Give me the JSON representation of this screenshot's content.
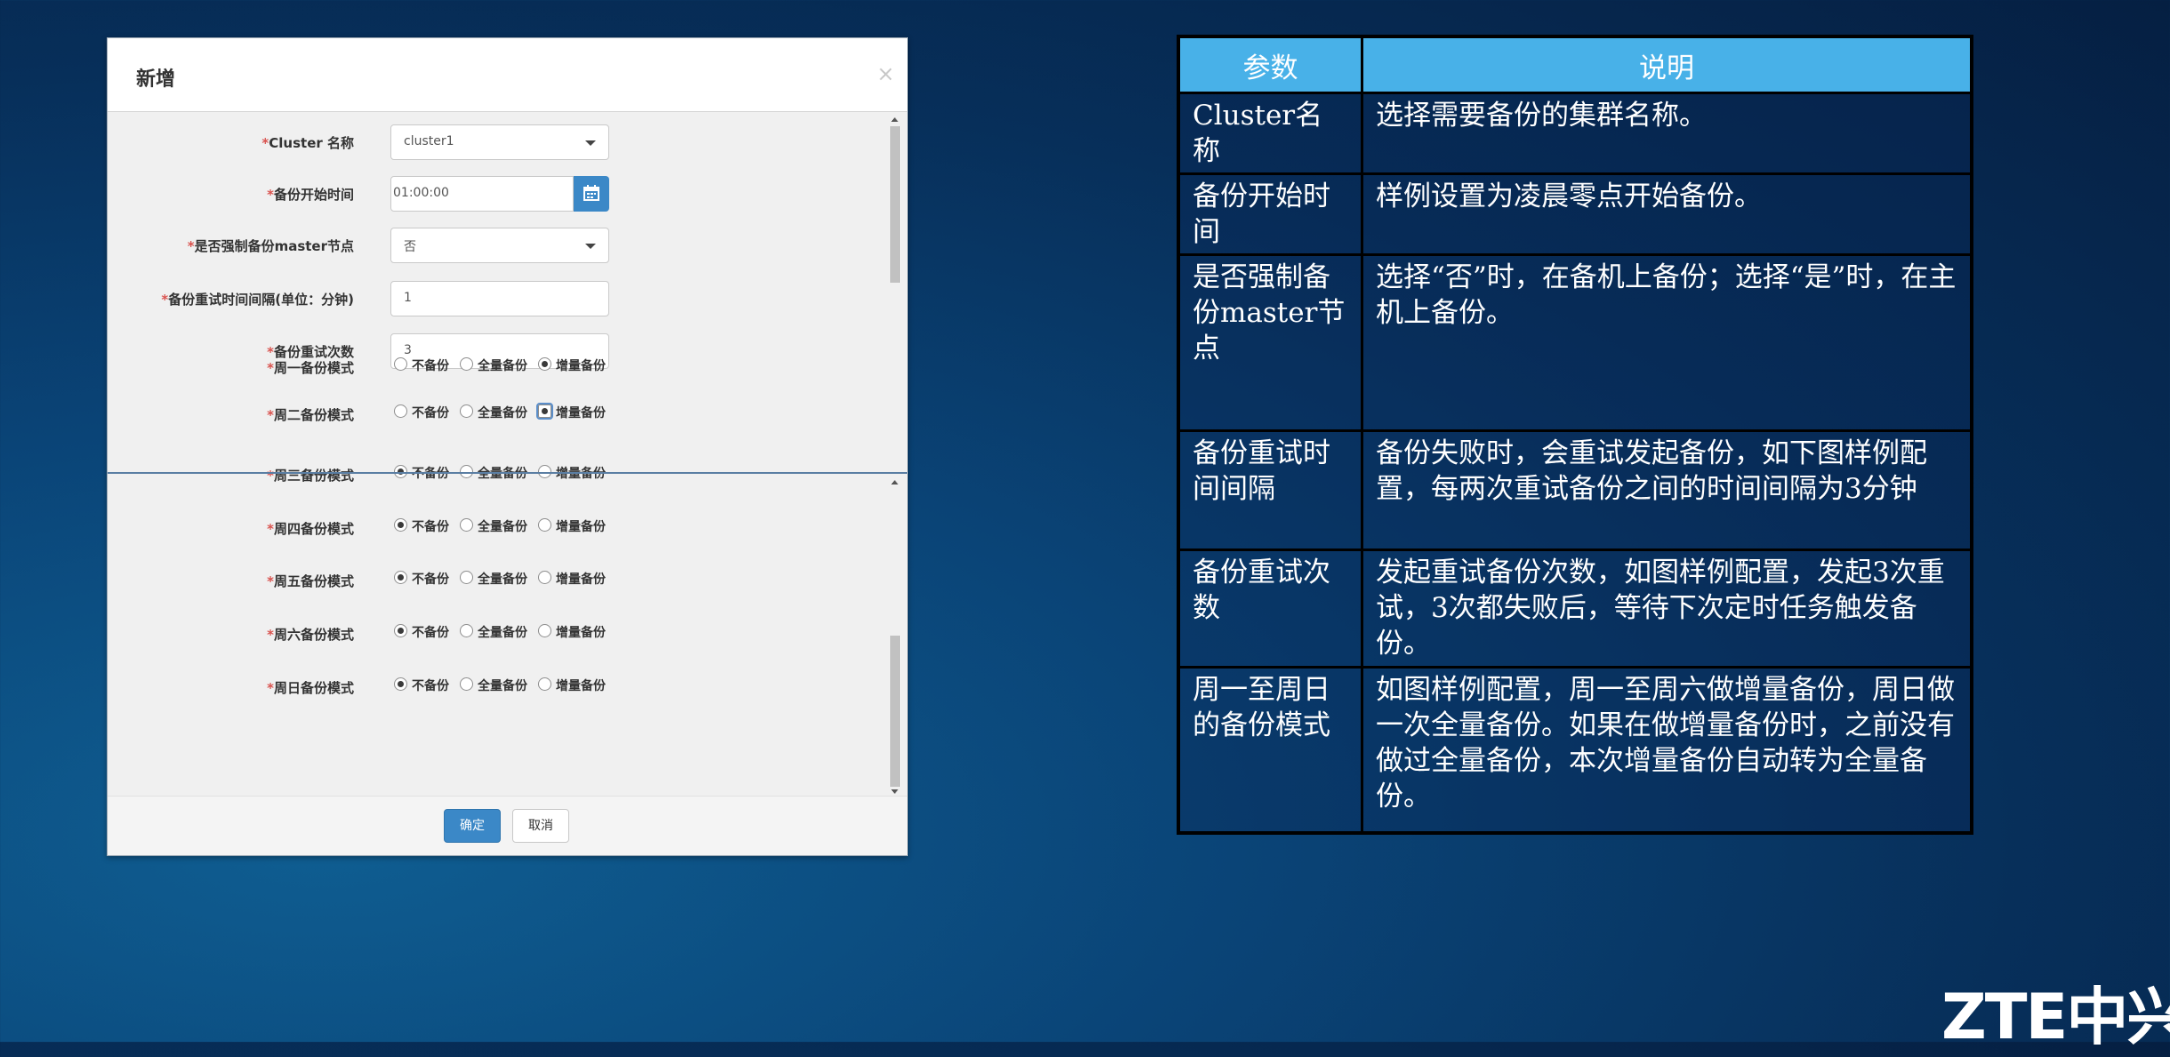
{
  "dialog": {
    "title": "新增",
    "close_symbol": "×",
    "fields": {
      "cluster": {
        "required": "*",
        "label": "Cluster 名称",
        "value": "cluster1"
      },
      "start_time": {
        "required": "*",
        "label": "备份开始时间",
        "value": "01:00:00"
      },
      "force_master": {
        "required": "*",
        "label": "是否强制备份master节点",
        "value": "否"
      },
      "retry_interval": {
        "required": "*",
        "label": "备份重试时间间隔(单位：分钟)",
        "value": "1"
      },
      "retry_count": {
        "required": "*",
        "label": "备份重试次数",
        "value": "3"
      }
    },
    "radio_options": [
      "不备份",
      "全量备份",
      "增量备份"
    ],
    "weekdays": [
      {
        "required": "*",
        "label": "周一备份模式",
        "selected": 2
      },
      {
        "required": "*",
        "label": "周二备份模式",
        "selected": 2
      },
      {
        "required": "*",
        "label": "周三备份模式",
        "selected": 0
      },
      {
        "required": "*",
        "label": "周四备份模式",
        "selected": 0
      },
      {
        "required": "*",
        "label": "周五备份模式",
        "selected": 0
      },
      {
        "required": "*",
        "label": "周六备份模式",
        "selected": 0
      },
      {
        "required": "*",
        "label": "周日备份模式",
        "selected": 0
      }
    ],
    "buttons": {
      "ok": "确定",
      "cancel": "取消"
    }
  },
  "table": {
    "headers": [
      "参数",
      "说明"
    ],
    "rows": [
      {
        "param": "Cluster名称",
        "desc": "选择需要备份的集群名称。"
      },
      {
        "param": "备份开始时间",
        "desc": "样例设置为凌晨零点开始备份。"
      },
      {
        "param": "是否强制备份master节点",
        "desc": "选择“否”时，在备机上备份；选择“是”时，在主机上备份。"
      },
      {
        "param": "备份重试时间间隔",
        "desc": "备份失败时，会重试发起备份，如下图样例配置，每两次重试备份之间的时间间隔为3分钟"
      },
      {
        "param": "备份重试次数",
        "desc": "发起重试备份次数，如图样例配置，发起3次重试，3次都失败后，等待下次定时任务触发备份。"
      },
      {
        "param": "周一至周日的备份模式",
        "desc": "如图样例配置，周一至周六做增量备份，周日做一次全量备份。如果在做增量备份时，之前没有做过全量备份，本次增量备份自动转为全量备份。"
      }
    ]
  },
  "logo": {
    "text": "ZTE中兴"
  }
}
